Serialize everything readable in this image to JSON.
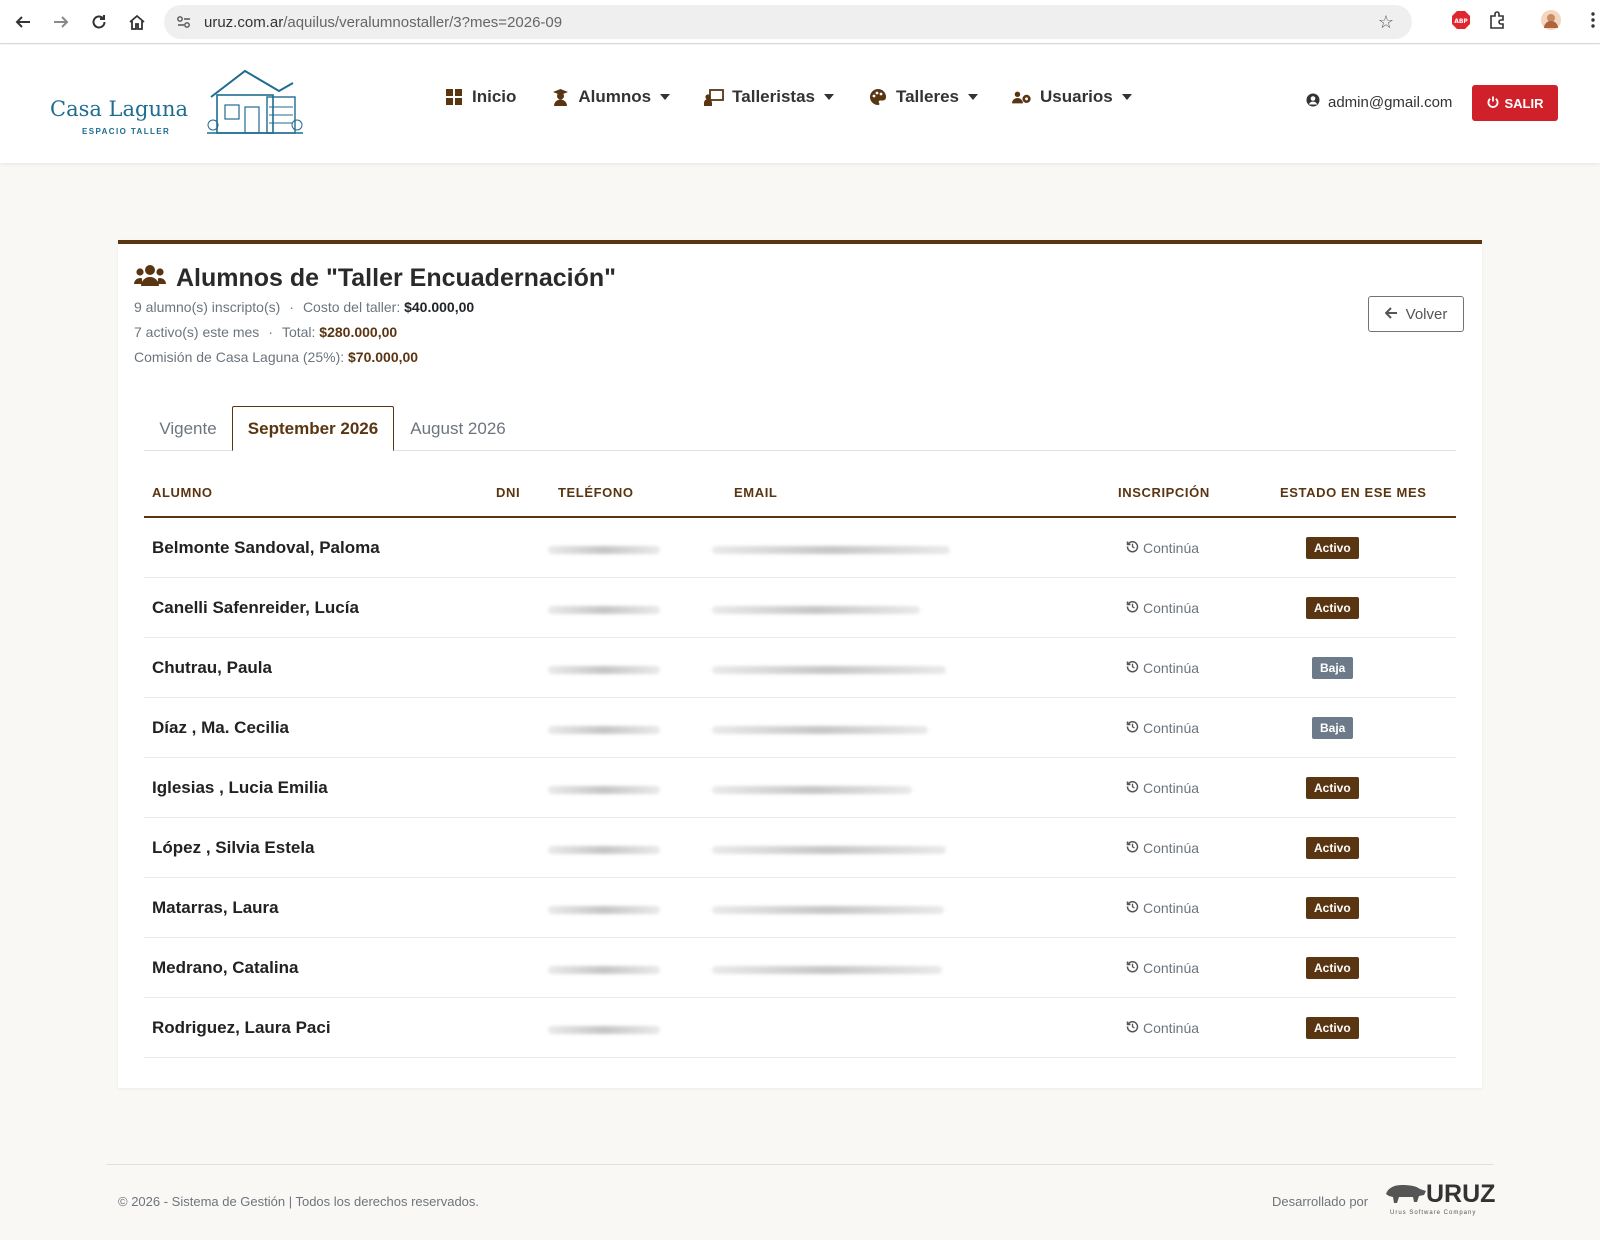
{
  "browser": {
    "url_host": "uruz.com.ar",
    "url_path": "/aquilus/veralumnostaller/3?mes=2026-09"
  },
  "header": {
    "logo_text": "Casa Laguna",
    "logo_subtext": "ESPACIO TALLER",
    "nav": [
      {
        "label": "Inicio",
        "icon": "grid-icon",
        "dropdown": false
      },
      {
        "label": "Alumnos",
        "icon": "student-icon",
        "dropdown": true
      },
      {
        "label": "Talleristas",
        "icon": "teacher-icon",
        "dropdown": true
      },
      {
        "label": "Talleres",
        "icon": "palette-icon",
        "dropdown": true
      },
      {
        "label": "Usuarios",
        "icon": "users-gear-icon",
        "dropdown": true
      }
    ],
    "user_email": "admin@gmail.com",
    "logout_label": "SALIR"
  },
  "card": {
    "title": "Alumnos de \"Taller Encuadernación\"",
    "enrolled_text": "9 alumno(s) inscripto(s)",
    "cost_label": "Costo del taller:",
    "cost_value": "$40.000,00",
    "active_text": "7 activo(s) este mes",
    "total_label": "Total:",
    "total_value": "$280.000,00",
    "commission_label": "Comisión de Casa Laguna (25%):",
    "commission_value": "$70.000,00",
    "back_label": "Volver"
  },
  "tabs": [
    {
      "label": "Vigente",
      "active": false
    },
    {
      "label": "September 2026",
      "active": true
    },
    {
      "label": "August 2026",
      "active": false
    }
  ],
  "table": {
    "headers": [
      "ALUMNO",
      "DNI",
      "TELÉFONO",
      "EMAIL",
      "INSCRIPCIÓN",
      "ESTADO EN ESE MES"
    ],
    "rows": [
      {
        "name": "Belmonte Sandoval, Paloma",
        "inscripcion": "Continúa",
        "estado": "Activo"
      },
      {
        "name": "Canelli Safenreider, Lucía",
        "inscripcion": "Continúa",
        "estado": "Activo"
      },
      {
        "name": "Chutrau, Paula",
        "inscripcion": "Continúa",
        "estado": "Baja"
      },
      {
        "name": "Díaz , Ma. Cecilia",
        "inscripcion": "Continúa",
        "estado": "Baja"
      },
      {
        "name": "Iglesias , Lucia Emilia",
        "inscripcion": "Continúa",
        "estado": "Activo"
      },
      {
        "name": "López , Silvia Estela",
        "inscripcion": "Continúa",
        "estado": "Activo"
      },
      {
        "name": "Matarras, Laura",
        "inscripcion": "Continúa",
        "estado": "Activo"
      },
      {
        "name": "Medrano, Catalina",
        "inscripcion": "Continúa",
        "estado": "Activo"
      },
      {
        "name": "Rodriguez, Laura Paci",
        "inscripcion": "Continúa",
        "estado": "Activo"
      }
    ]
  },
  "footer": {
    "copyright": "© 2026 - Sistema de Gestión | Todos los derechos reservados.",
    "developed_by": "Desarrollado por",
    "dev_logo_text": "URUZ",
    "dev_logo_sub": "Urus Software Company"
  },
  "colors": {
    "brand_brown": "#5a3512",
    "logout_red": "#d0202a",
    "logo_blue": "#1e6c8f",
    "baja_gray": "#6c7a89"
  }
}
